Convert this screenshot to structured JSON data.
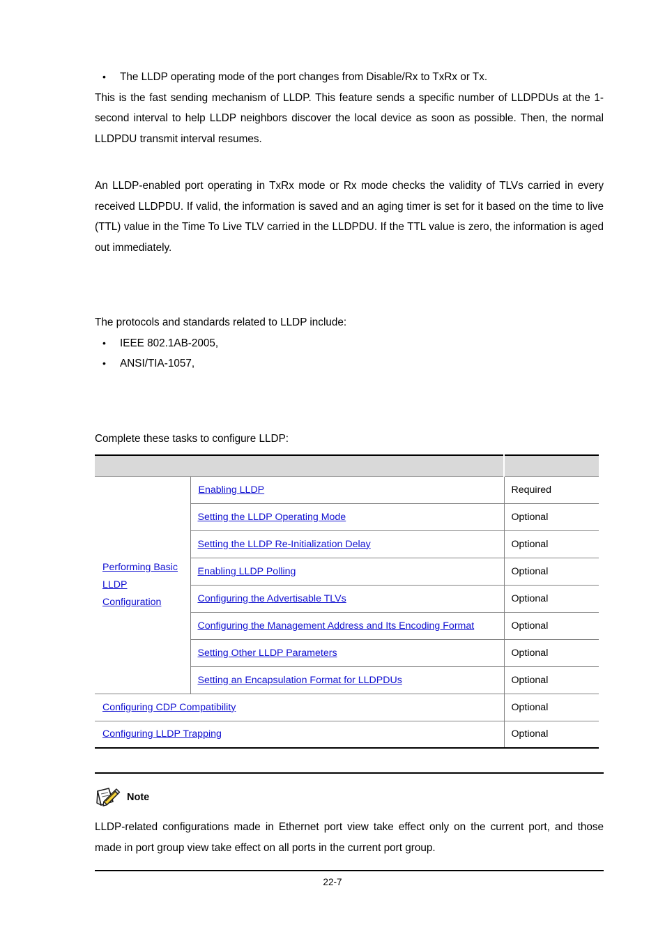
{
  "page": {
    "footer_page_number": "22-7"
  },
  "intro": {
    "bullet_items": [
      "The LLDP operating mode of the port changes from Disable/Rx to TxRx or Tx."
    ],
    "paragraph_1": "This is the fast sending mechanism of LLDP. This feature sends a specific number of LLDPDUs at the 1-second interval to help LLDP neighbors discover the local device as soon as possible. Then, the normal LLDPDU transmit interval resumes.",
    "paragraph_2": "An LLDP-enabled port operating in TxRx mode or Rx mode checks the validity of TLVs carried in every received LLDPDU. If valid, the information is saved and an aging timer is set for it based on the time to live (TTL) value in the Time To Live TLV carried in the LLDPDU. If the TTL value is zero, the information is aged out immediately."
  },
  "protocols": {
    "lead_in": "The protocols and standards related to LLDP include:",
    "items": [
      "IEEE 802.1AB-2005,",
      "ANSI/TIA-1057,"
    ]
  },
  "tasks": {
    "lead_in": "Complete these tasks to configure LLDP:",
    "header": {
      "col_task": "",
      "col_requirement": ""
    },
    "group": {
      "label_lines": [
        "Performing Basic ",
        "LLDP ",
        "Configuration"
      ]
    },
    "rows": [
      {
        "task": "Enabling LLDP",
        "requirement": "Required"
      },
      {
        "task": "Setting the LLDP Operating Mode",
        "requirement": "Optional"
      },
      {
        "task": "Setting the LLDP Re-Initialization Delay",
        "requirement": "Optional"
      },
      {
        "task": "Enabling LLDP Polling",
        "requirement": "Optional"
      },
      {
        "task": "Configuring the Advertisable TLVs",
        "requirement": "Optional"
      },
      {
        "task": "Configuring the Management Address and Its Encoding Format",
        "requirement": "Optional"
      },
      {
        "task": "Setting Other LLDP Parameters",
        "requirement": "Optional"
      },
      {
        "task": "Setting an Encapsulation Format for LLDPDUs",
        "requirement": "Optional"
      }
    ],
    "standalone_rows": [
      {
        "task": "Configuring CDP Compatibility",
        "requirement": "Optional"
      },
      {
        "task": "Configuring LLDP Trapping",
        "requirement": "Optional"
      }
    ]
  },
  "note": {
    "icon": "note-pencil-icon",
    "label": "Note",
    "text": "LLDP-related configurations made in Ethernet port view take effect only on the current port, and those made in port group view take effect on all ports in the current port group."
  },
  "colors": {
    "link": "#1010d0",
    "table_header_bg": "#d9d9d9",
    "rule": "#000000"
  }
}
